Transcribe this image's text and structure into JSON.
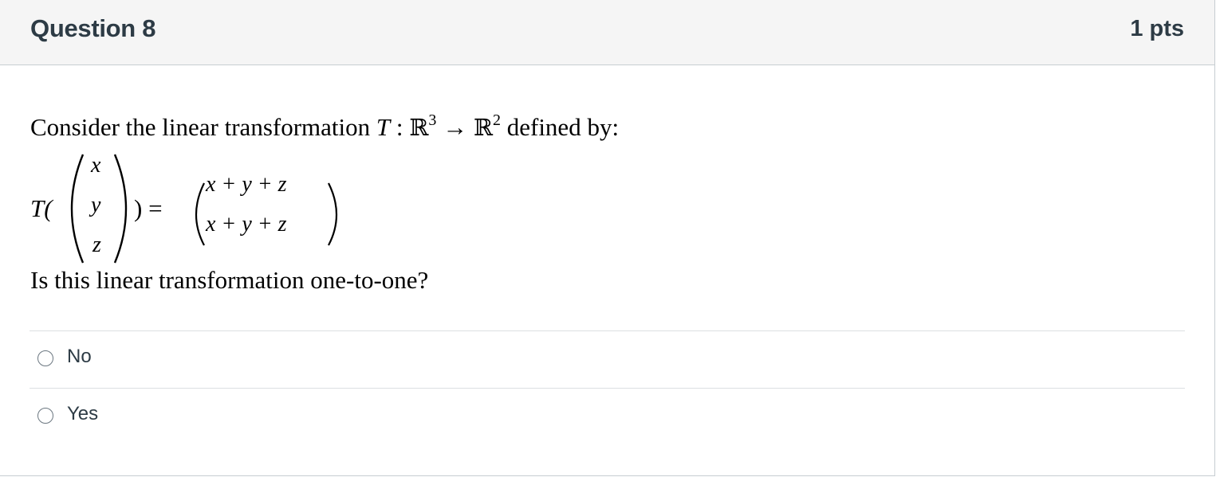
{
  "question": {
    "title": "Question 8",
    "points": "1 pts"
  },
  "prompt": {
    "intro_text": "Consider the linear transformation ",
    "T": "T",
    "colon": " : ",
    "domain_set": "ℝ",
    "domain_exp": "3",
    "arrow": " → ",
    "codomain_set": "ℝ",
    "codomain_exp": "2",
    "defined_by": " defined by:",
    "lhs_prefix": "T(",
    "lhs_suffix": ") =",
    "input_vector": [
      "x",
      "y",
      "z"
    ],
    "output_vector": [
      "x + y + z",
      "x + y + z"
    ],
    "question_text": "Is this linear transformation one-to-one?"
  },
  "answers": [
    {
      "label": "No"
    },
    {
      "label": "Yes"
    }
  ]
}
